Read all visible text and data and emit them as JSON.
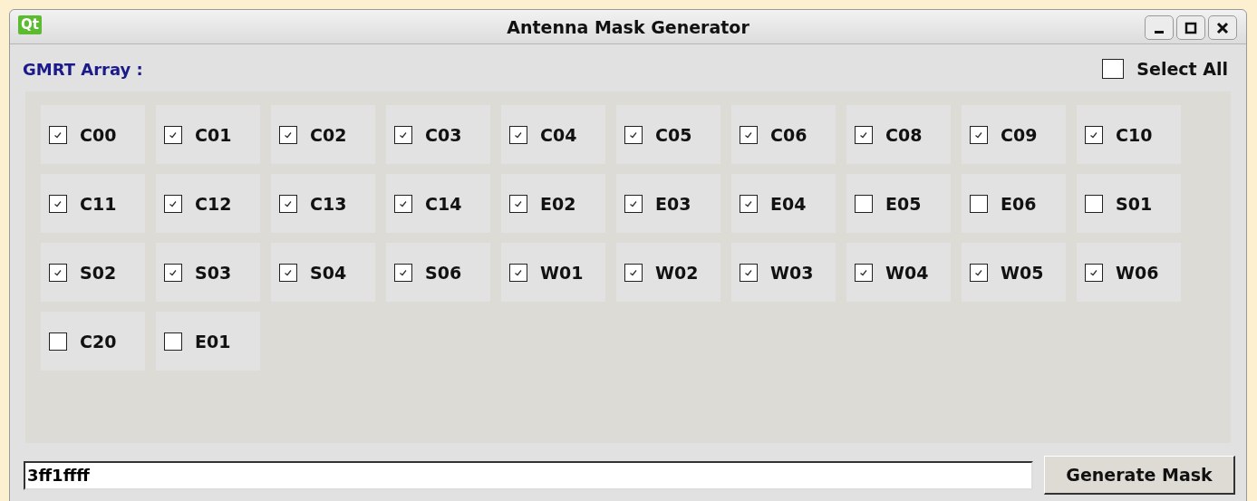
{
  "window": {
    "logo": "Qt",
    "title": "Antenna Mask Generator"
  },
  "array_label": "GMRT Array :",
  "select_all": {
    "label": "Select All",
    "checked": false
  },
  "antennas": [
    {
      "label": "C00",
      "checked": true
    },
    {
      "label": "C01",
      "checked": true
    },
    {
      "label": "C02",
      "checked": true
    },
    {
      "label": "C03",
      "checked": true
    },
    {
      "label": "C04",
      "checked": true
    },
    {
      "label": "C05",
      "checked": true
    },
    {
      "label": "C06",
      "checked": true
    },
    {
      "label": "C08",
      "checked": true
    },
    {
      "label": "C09",
      "checked": true
    },
    {
      "label": "C10",
      "checked": true
    },
    {
      "label": "C11",
      "checked": true
    },
    {
      "label": "C12",
      "checked": true
    },
    {
      "label": "C13",
      "checked": true
    },
    {
      "label": "C14",
      "checked": true
    },
    {
      "label": "E02",
      "checked": true
    },
    {
      "label": "E03",
      "checked": true
    },
    {
      "label": "E04",
      "checked": true
    },
    {
      "label": "E05",
      "checked": false
    },
    {
      "label": "E06",
      "checked": false
    },
    {
      "label": "S01",
      "checked": false
    },
    {
      "label": "S02",
      "checked": true
    },
    {
      "label": "S03",
      "checked": true
    },
    {
      "label": "S04",
      "checked": true
    },
    {
      "label": "S06",
      "checked": true
    },
    {
      "label": "W01",
      "checked": true
    },
    {
      "label": "W02",
      "checked": true
    },
    {
      "label": "W03",
      "checked": true
    },
    {
      "label": "W04",
      "checked": true
    },
    {
      "label": "W05",
      "checked": true
    },
    {
      "label": "W06",
      "checked": true
    },
    {
      "label": "C20",
      "checked": false
    },
    {
      "label": "E01",
      "checked": false
    }
  ],
  "mask_field": {
    "value": "3ff1ffff"
  },
  "generate_button": "Generate Mask"
}
